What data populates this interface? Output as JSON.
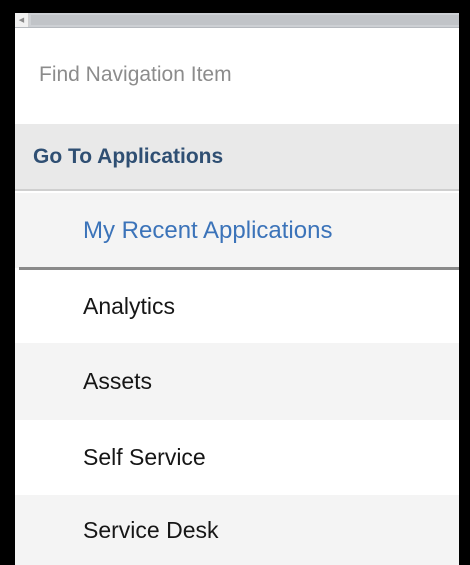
{
  "search": {
    "placeholder": "Find Navigation Item"
  },
  "section": {
    "title": "Go To Applications"
  },
  "recent": {
    "label": "My Recent Applications"
  },
  "applications": [
    {
      "label": "Analytics"
    },
    {
      "label": "Assets"
    },
    {
      "label": "Self Service"
    },
    {
      "label": "Service Desk"
    }
  ],
  "colors": {
    "header_text": "#2f4f73",
    "link": "#3b73b9",
    "header_bg": "#e9e9e9",
    "alt_row_bg": "#f4f4f4"
  },
  "icons": {
    "scroll_left": "triangle-left"
  }
}
